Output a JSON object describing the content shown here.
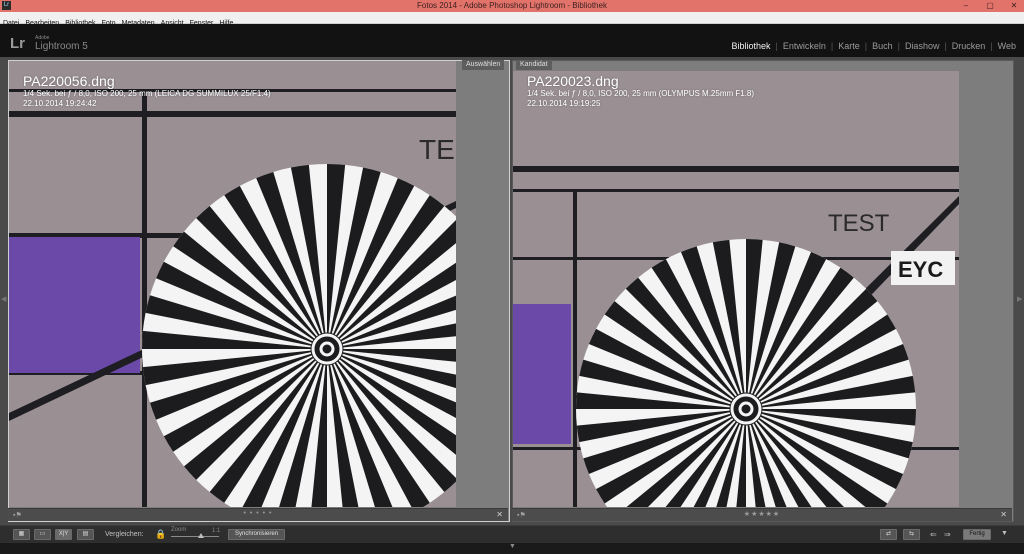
{
  "window": {
    "title": "Fotos 2014 - Adobe Photoshop Lightroom - Bibliothek",
    "app_icon": "Lr",
    "controls": [
      "–",
      "▢",
      "✕"
    ]
  },
  "menu": [
    "Datei",
    "Bearbeiten",
    "Bibliothek",
    "Foto",
    "Metadaten",
    "Ansicht",
    "Fenster",
    "Hilfe"
  ],
  "header": {
    "logo_mark": "Lr",
    "logo_adobe": "Adobe",
    "logo_name": "Lightroom 5",
    "modules": [
      {
        "label": "Bibliothek",
        "active": true
      },
      {
        "label": "Entwickeln",
        "active": false
      },
      {
        "label": "Karte",
        "active": false
      },
      {
        "label": "Buch",
        "active": false
      },
      {
        "label": "Diashow",
        "active": false
      },
      {
        "label": "Drucken",
        "active": false
      },
      {
        "label": "Web",
        "active": false
      }
    ]
  },
  "compare": {
    "select": {
      "tag": "Auswählen",
      "filename": "PA220056.dng",
      "exposure": "1/4 Sek. bei ƒ / 8,0, ISO 200, 25 mm (LEICA DG SUMMILUX 25/F1.4)",
      "date": "22.10.2014 19:24:42",
      "test_text": "TE",
      "stars": "• • • • •",
      "close": "✕"
    },
    "candidate": {
      "tag": "Kandidat",
      "filename": "PA220023.dng",
      "exposure": "1/4 Sek. bei ƒ / 8,0, ISO 200, 25 mm (OLYMPUS M.25mm F1.8)",
      "date": "22.10.2014 19:19:25",
      "test_text": "TEST",
      "eyc_text": "EYC",
      "stars": "★★★★★",
      "close": "✕"
    }
  },
  "toolbar": {
    "compare_label": "Vergleichen:",
    "zoom_label": "Zoom",
    "zoom_value": "1:1",
    "sync_label": "Synchronisieren",
    "done_label": "Fertig",
    "xy_label": "X|Y"
  },
  "colors": {
    "titlebar": "#e2736b",
    "paper": "#978e92",
    "purple": "#6a49a8",
    "active_module": "#f0f0f0"
  }
}
